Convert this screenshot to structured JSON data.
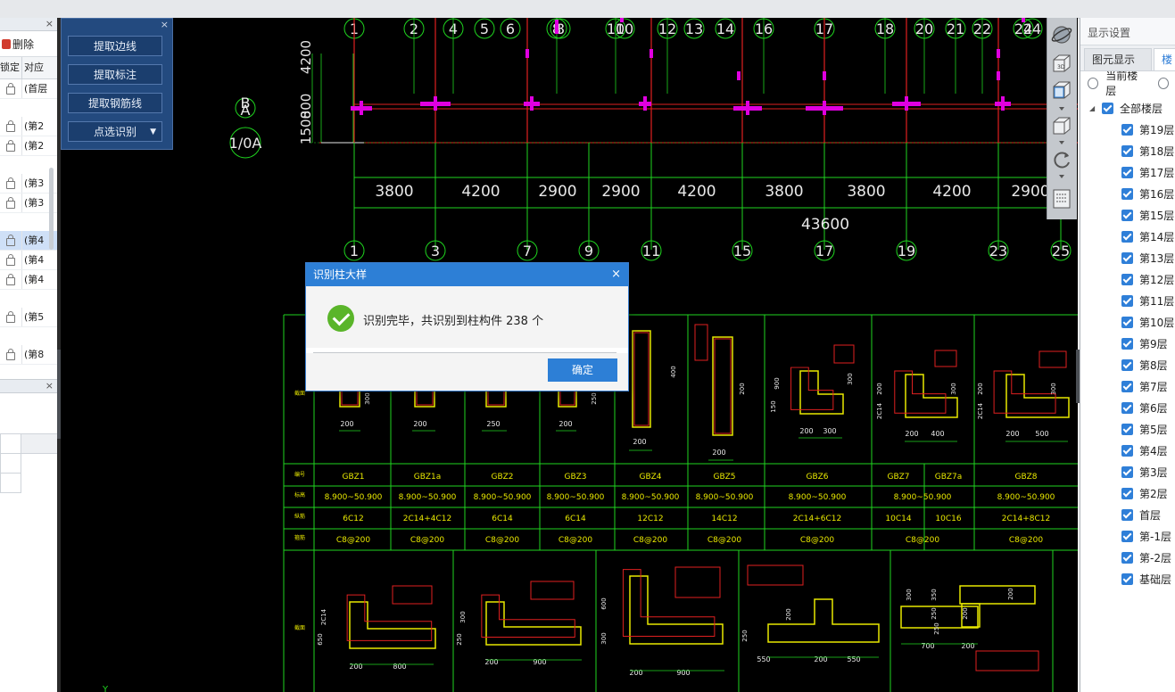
{
  "left_panel": {
    "delete_label": "删除",
    "col_lock": "锁定",
    "col_target": "对应",
    "rows": [
      {
        "val": "(首层",
        "selected": false
      },
      {
        "val": "(第2",
        "selected": false
      },
      {
        "val": "(第2",
        "selected": false
      },
      {
        "val": "(第3",
        "selected": false
      },
      {
        "val": "(第3",
        "selected": false
      },
      {
        "val": "(第4",
        "selected": true
      },
      {
        "val": "(第4",
        "selected": false
      },
      {
        "val": "(第4",
        "selected": false
      },
      {
        "val": "(第5",
        "selected": false
      },
      {
        "val": "(第8",
        "selected": false
      }
    ]
  },
  "tool_panel": {
    "btn_extract_edge": "提取边线",
    "btn_extract_label": "提取标注",
    "btn_extract_rebar": "提取钢筋线",
    "btn_point_identify": "点选识别"
  },
  "cad": {
    "top_axes": [
      "1",
      "2",
      "4",
      "5",
      "6",
      "8",
      "8",
      "10",
      "10",
      "12",
      "13",
      "14",
      "16",
      "17",
      "18",
      "20",
      "21",
      "22",
      "24",
      "24"
    ],
    "top_axes_partial": [
      "3",
      "9",
      "11"
    ],
    "row_labels": [
      "B",
      "A",
      "1/0A"
    ],
    "vertical_dims": [
      "4200",
      "800",
      "1500"
    ],
    "spans": [
      "3800",
      "4200",
      "2900",
      "2900",
      "4200",
      "3800",
      "3800",
      "4200",
      "2900"
    ],
    "total": "43600",
    "bottom_axes": [
      "1",
      "3",
      "7",
      "9",
      "11",
      "15",
      "17",
      "19",
      "23",
      "25"
    ],
    "table_row_labels": [
      "截面",
      "编号",
      "标高",
      "纵筋",
      "箍筋"
    ],
    "col_names": [
      "GBZ1",
      "GBZ1a",
      "GBZ2",
      "GBZ3",
      "GBZ4",
      "GBZ5",
      "GBZ6",
      "GBZ7",
      "GBZ7a",
      "GBZ8"
    ],
    "elev": [
      "8.900~50.900",
      "8.900~50.900",
      "8.900~50.900",
      "8.900~50.900",
      "8.900~50.900",
      "8.900~50.900",
      "8.900~50.900",
      "8.900~50.900",
      "8.900~50.900"
    ],
    "rebar": [
      "6C12",
      "2C14+4C12",
      "6C14",
      "6C14",
      "12C12",
      "14C12",
      "2C14+6C12",
      "10C14",
      "10C16",
      "2C14+8C12"
    ],
    "stirrup": [
      "C8@200",
      "C8@200",
      "C8@200",
      "C8@200",
      "C8@200",
      "C8@200",
      "C8@200",
      "C8@200",
      "C8@200"
    ],
    "dims_a": [
      "200",
      "200",
      "250",
      "200",
      "200",
      "200",
      "200",
      "300",
      "200",
      "400",
      "200",
      "500"
    ],
    "dims_b": [
      "200",
      "800",
      "200",
      "900",
      "200",
      "900",
      "550",
      "200",
      "550",
      "700",
      "200"
    ],
    "small_dims": [
      "300",
      "250",
      "400",
      "200",
      "900",
      "150",
      "300",
      "200",
      "2C14",
      "300",
      "200",
      "2C14",
      "300",
      "200",
      "2C14",
      "650",
      "300",
      "250",
      "600",
      "300",
      "250",
      "200",
      "300",
      "350",
      "250",
      "250",
      "200"
    ],
    "axis_y": "Y"
  },
  "right_panel": {
    "title": "显示设置",
    "tab_elements": "图元显示",
    "tab_floors": "楼",
    "radio_current": "当前楼层",
    "tree_all": "全部楼层",
    "floors": [
      "第19层",
      "第18层",
      "第17层",
      "第16层",
      "第15层",
      "第14层",
      "第13层",
      "第12层",
      "第11层",
      "第10层",
      "第9层",
      "第8层",
      "第7层",
      "第6层",
      "第5层",
      "第4层",
      "第3层",
      "第2层",
      "首层",
      "第-1层",
      "第-2层",
      "基础层"
    ]
  },
  "dialog": {
    "title": "识别柱大样",
    "message": "识别完毕，共识别到柱构件 238 个",
    "ok": "确定"
  },
  "colors": {
    "grid_red": "#e02020",
    "grid_green": "#1fd41f",
    "magenta": "#e000e0",
    "dialog_blue": "#2d7fd6",
    "success_green": "#5ab52a"
  }
}
